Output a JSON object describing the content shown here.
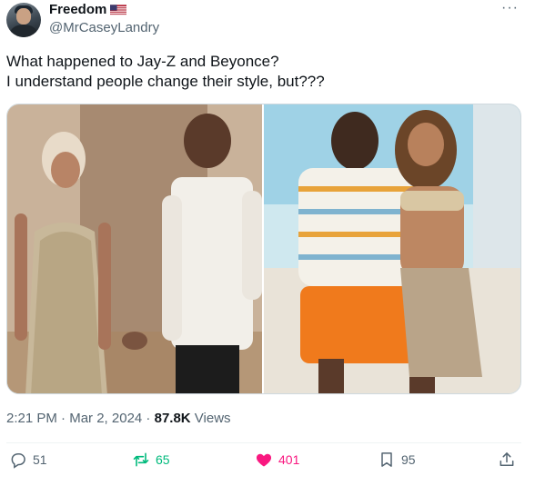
{
  "author": {
    "display_name": "Freedom",
    "flag_icon": "us-flag-icon",
    "handle": "@MrCaseyLandry"
  },
  "more_label": "···",
  "tweet": {
    "line1": "What happened to Jay-Z and Beyonce?",
    "line2": "I understand people change their style, but???"
  },
  "media": {
    "left_alt": "photo-left",
    "right_alt": "photo-right"
  },
  "meta": {
    "time": "2:21 PM",
    "sep1": " · ",
    "date": "Mar 2, 2024",
    "sep2": " · ",
    "views_count": "87.8K",
    "views_label": " Views"
  },
  "actions": {
    "replies": "51",
    "reposts": "65",
    "likes": "401",
    "bookmarks": "95"
  },
  "colors": {
    "text": "#0f1419",
    "muted": "#536471",
    "repost": "#00ba7c",
    "like": "#f91880"
  }
}
